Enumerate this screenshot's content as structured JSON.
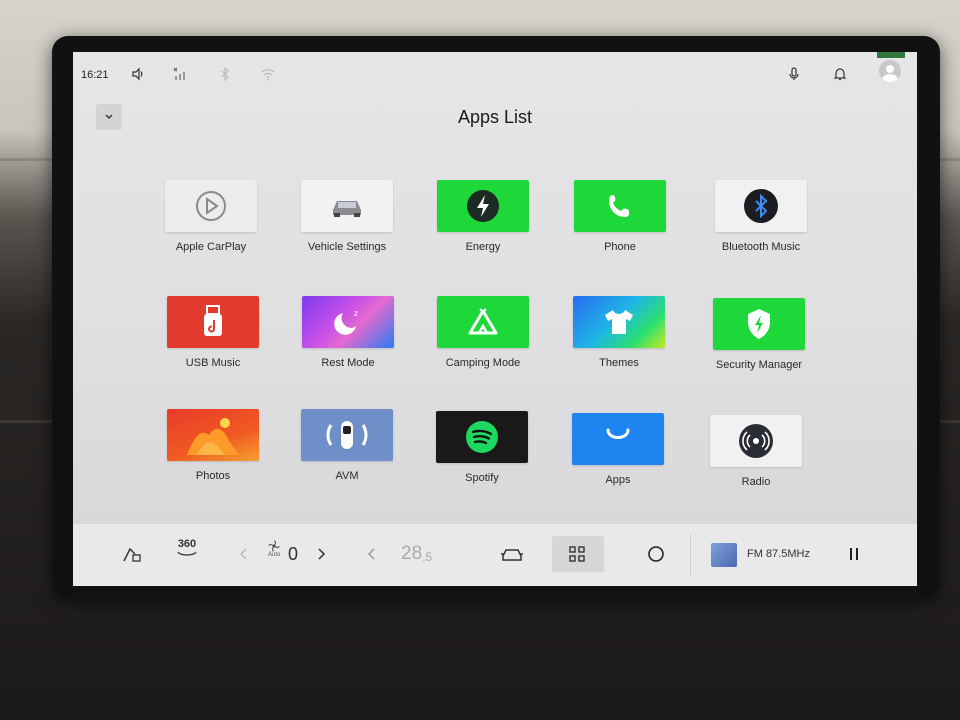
{
  "status": {
    "time": "16:21"
  },
  "header": {
    "title": "Apps List"
  },
  "apps": [
    {
      "label": "Apple CarPlay",
      "icon": "play-icon"
    },
    {
      "label": "Vehicle Settings",
      "icon": "car-icon"
    },
    {
      "label": "Energy",
      "icon": "lightning-icon"
    },
    {
      "label": "Phone",
      "icon": "phone-icon"
    },
    {
      "label": "Bluetooth Music",
      "icon": "bluetooth-icon"
    },
    {
      "label": "USB Music",
      "icon": "usb-icon"
    },
    {
      "label": "Rest Mode",
      "icon": "moon-icon"
    },
    {
      "label": "Camping Mode",
      "icon": "tent-icon"
    },
    {
      "label": "Themes",
      "icon": "tshirt-icon"
    },
    {
      "label": "Security Manager",
      "icon": "shield-icon"
    },
    {
      "label": "Photos",
      "icon": "photos-icon"
    },
    {
      "label": "AVM",
      "icon": "avm-icon"
    },
    {
      "label": "Spotify",
      "icon": "spotify-icon"
    },
    {
      "label": "Apps",
      "icon": "appstore-icon"
    },
    {
      "label": "Radio",
      "icon": "radio-icon"
    }
  ],
  "dock": {
    "view_360_label": "360",
    "fan_mode": "Auto",
    "fan_level": "0",
    "temperature_main": "28",
    "temperature_decimal": ".5",
    "media_station": "FM 87.5MHz"
  },
  "colors": {
    "green": "#1ed83a",
    "blue": "#1e84f0",
    "red": "#e33a2e",
    "screen_bg": "#e4e4e6"
  }
}
